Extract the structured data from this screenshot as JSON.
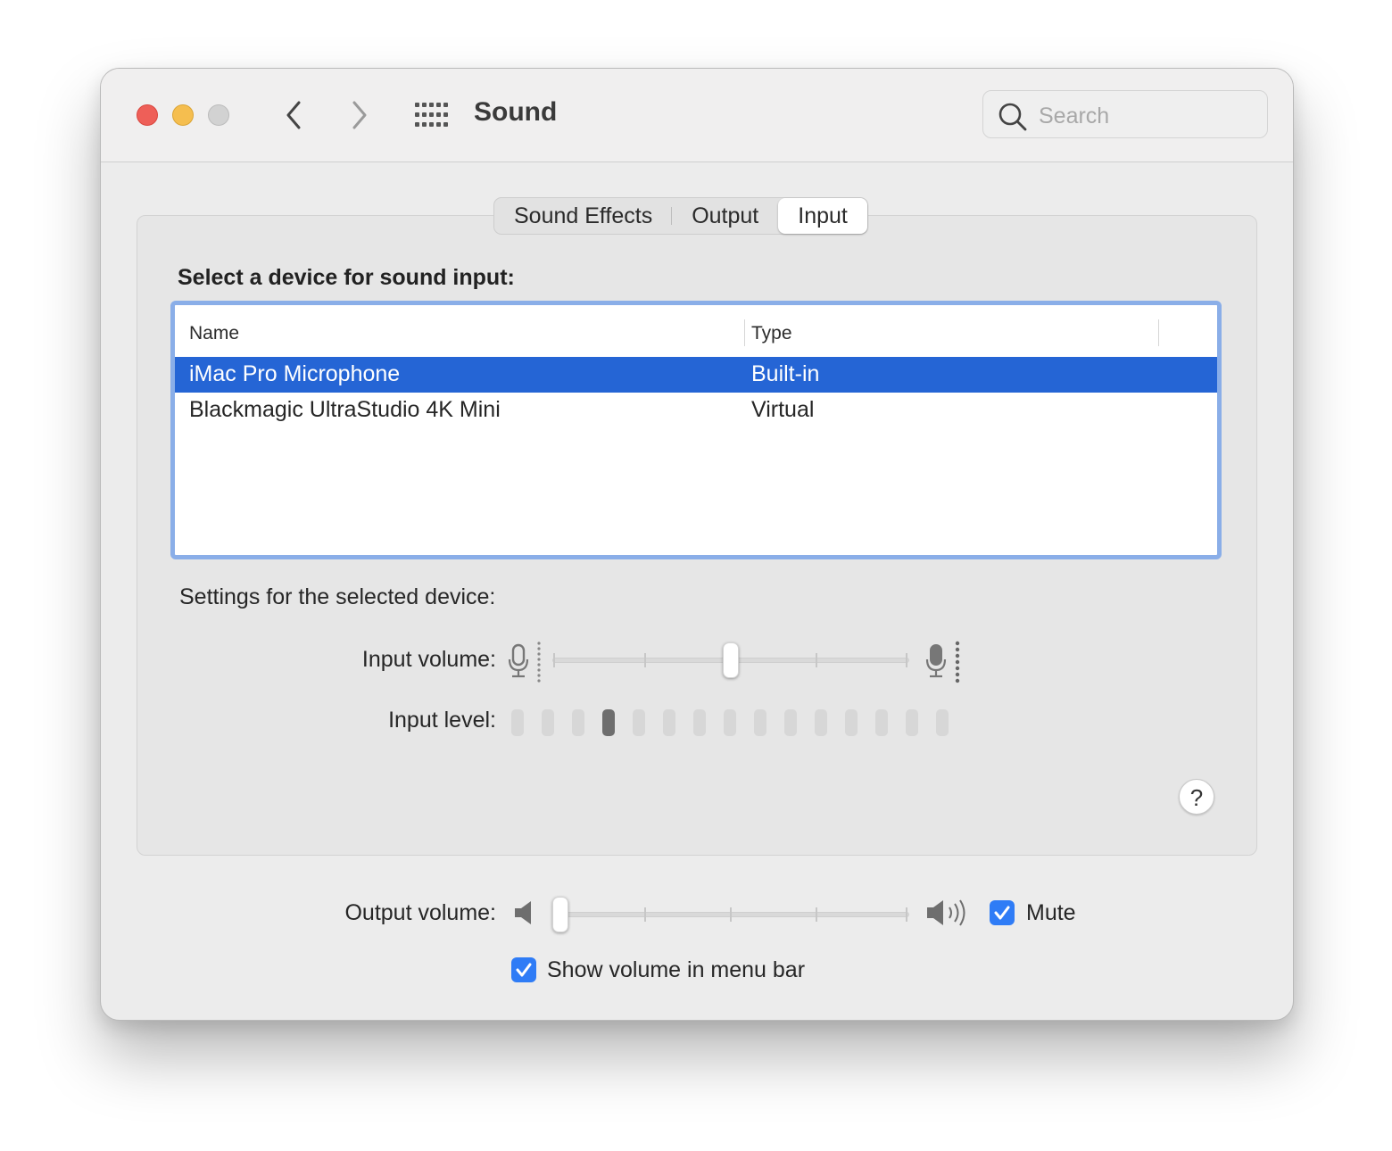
{
  "window": {
    "title": "Sound",
    "search": {
      "placeholder": "Search",
      "value": ""
    }
  },
  "tabs": [
    {
      "label": "Sound Effects",
      "active": false
    },
    {
      "label": "Output",
      "active": false
    },
    {
      "label": "Input",
      "active": true
    }
  ],
  "input": {
    "section_title": "Select a device for sound input:",
    "table": {
      "columns": [
        "Name",
        "Type"
      ],
      "rows": [
        {
          "name": "iMac Pro Microphone",
          "type": "Built-in",
          "selected": true
        },
        {
          "name": "Blackmagic UltraStudio 4K Mini",
          "type": "Virtual",
          "selected": false
        }
      ]
    },
    "settings_title": "Settings for the selected device:",
    "input_volume_label": "Input volume:",
    "input_volume_fraction": 0.5,
    "input_level_label": "Input level:",
    "input_level": {
      "segments": 15,
      "active_index": 3
    }
  },
  "output_volume_label": "Output volume:",
  "output_volume_fraction": 0.0,
  "mute": {
    "label": "Mute",
    "checked": true
  },
  "show_volume": {
    "label": "Show volume in menu bar",
    "checked": true
  },
  "help_label": "?",
  "colors": {
    "accent": "#2f7cf6",
    "selection": "#2565d5",
    "focus_ring": "#8aaee8"
  }
}
